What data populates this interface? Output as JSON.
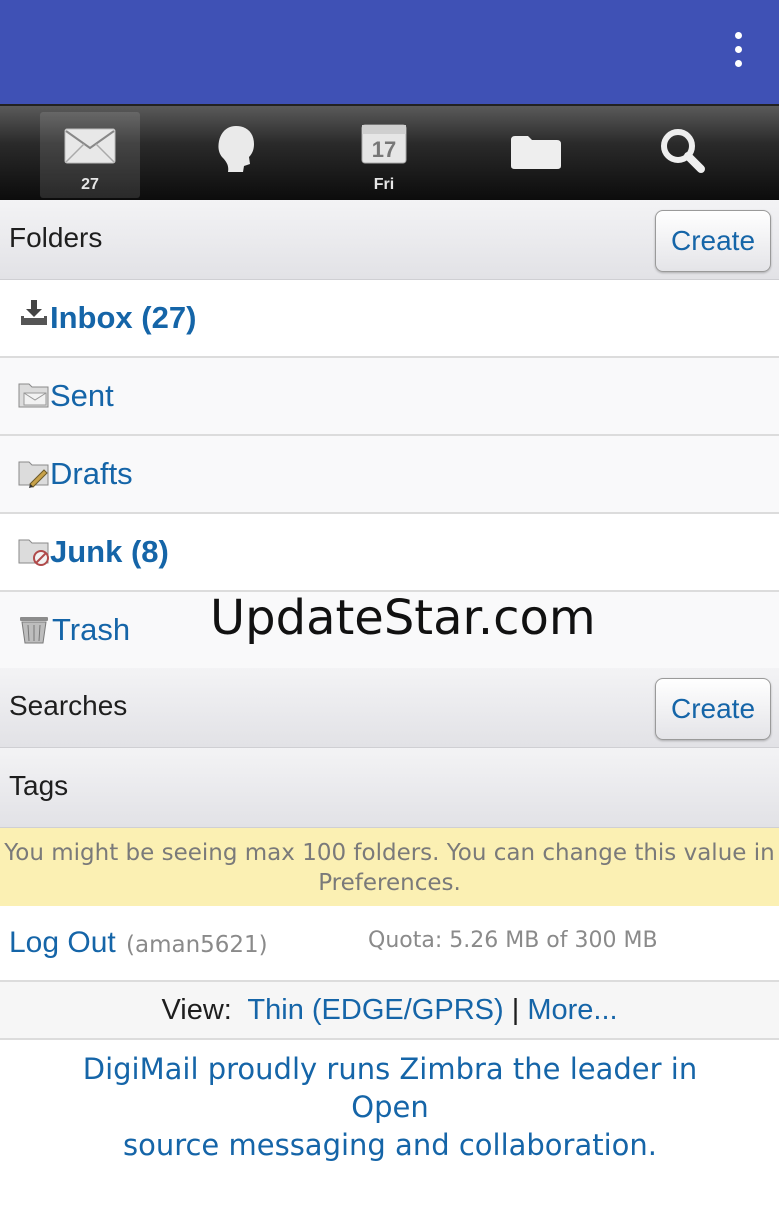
{
  "appbar": {
    "menu_icon": "more-vert-icon"
  },
  "toolbar": {
    "items": [
      {
        "name": "mail",
        "icon": "envelope-icon",
        "caption": "27",
        "active": true
      },
      {
        "name": "contacts",
        "icon": "contact-head-icon",
        "caption": "",
        "active": false
      },
      {
        "name": "calendar",
        "icon": "calendar-icon",
        "day_number": "17",
        "caption": "Fri",
        "active": false
      },
      {
        "name": "briefcase",
        "icon": "folder-icon",
        "caption": "",
        "active": false
      },
      {
        "name": "search",
        "icon": "search-icon",
        "caption": "",
        "active": false
      }
    ]
  },
  "folders_section": {
    "title": "Folders",
    "create_label": "Create"
  },
  "folders": [
    {
      "label": "Inbox (27)",
      "icon": "inbox-download-icon",
      "bold": true
    },
    {
      "label": "Sent",
      "icon": "sent-folder-icon",
      "bold": false
    },
    {
      "label": "Drafts",
      "icon": "drafts-folder-icon",
      "bold": false
    },
    {
      "label": "Junk (8)",
      "icon": "junk-folder-icon",
      "bold": true
    },
    {
      "label": "Trash",
      "icon": "trash-icon",
      "bold": false
    }
  ],
  "watermark": "UpdateStar.com",
  "searches_section": {
    "title": "Searches",
    "create_label": "Create"
  },
  "tags_section": {
    "title": "Tags"
  },
  "notice": {
    "line1": "You might be seeing max 100 folders. You can change this value in",
    "line2": "Preferences."
  },
  "account": {
    "logout_label": "Log Out",
    "username": "(aman5621)",
    "quota": "Quota: 5.26 MB of 300 MB"
  },
  "view": {
    "label": "View:",
    "thin_link": "Thin (EDGE/GPRS)",
    "separator": "|",
    "more_link": "More..."
  },
  "footer": {
    "line1": "DigiMail proudly runs Zimbra the leader in Open",
    "line2": "source messaging and collaboration."
  },
  "colors": {
    "appbar": "#3f51b5",
    "link": "#1565a8",
    "notice_bg": "#fbf0b3"
  }
}
